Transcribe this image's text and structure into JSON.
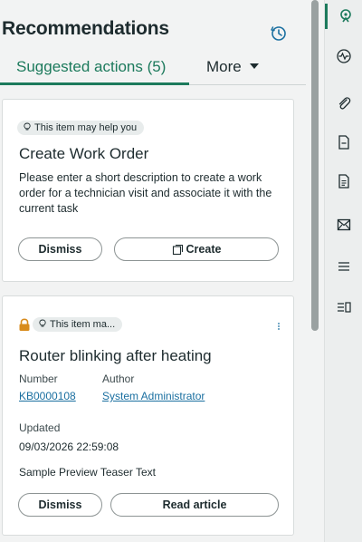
{
  "header": {
    "title": "Recommendations"
  },
  "tabs": {
    "active_label": "Suggested actions (5)",
    "more_label": "More"
  },
  "cards": [
    {
      "badge": "This item may help you",
      "title": "Create Work Order",
      "description": "Please enter a short description to create a work order for a technician visit and associate it with the current task",
      "dismiss_label": "Dismiss",
      "action_label": "Create"
    },
    {
      "badge": "This item ma...",
      "title": "Router blinking after heating",
      "number_label": "Number",
      "number_value": "KB0000108",
      "author_label": "Author",
      "author_value": "System Administrator",
      "updated_label": "Updated",
      "updated_value": "09/03/2026 22:59:08",
      "teaser": "Sample Preview Teaser Text",
      "dismiss_label": "Dismiss",
      "action_label": "Read article"
    }
  ],
  "rail": {
    "items": [
      "recommendations-icon",
      "activity-icon",
      "attachment-icon",
      "document-icon",
      "document-lines-icon",
      "email-icon",
      "list-icon",
      "split-list-icon"
    ]
  },
  "colors": {
    "accent": "#1c7a5c",
    "link": "#1a6fa0",
    "lock": "#d88b1c"
  }
}
